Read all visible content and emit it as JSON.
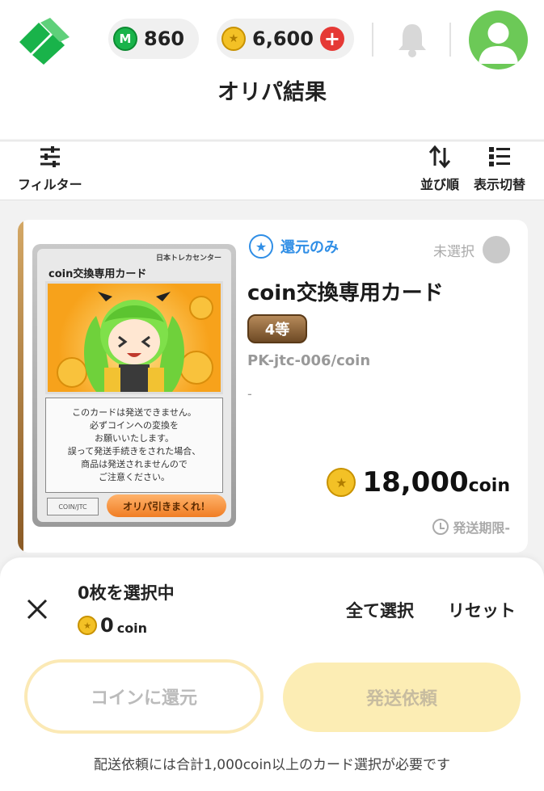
{
  "header": {
    "m_points": "860",
    "m_badge": "M",
    "coins": "6,600",
    "plus": "+"
  },
  "page": {
    "title": "オリパ結果"
  },
  "toolbar": {
    "filter_label": "フィルター",
    "sort_label": "並び順",
    "view_label": "表示切替"
  },
  "card": {
    "image": {
      "top_label": "日本トレカセンター",
      "name": "coin交換専用カード",
      "text_lines": [
        "このカードは発送できません。",
        "必ずコインへの変換を",
        "お願いいたします。",
        "誤って発送手続きをされた場合、",
        "商品は発送されませんので",
        "ご注意ください。"
      ],
      "code": "COIN/JTC",
      "button": "オリパ引きまくれ！"
    },
    "refund_tag": "還元のみ",
    "selection_status": "未選択",
    "name": "coin交換専用カード",
    "rank": "4等",
    "product_code": "PK-jtc-006/coin",
    "extra": "-",
    "price": "18,000",
    "price_unit": "coin",
    "deadline": "発送期限-"
  },
  "sheet": {
    "selected_count": "0枚を選択中",
    "selected_coin": "0",
    "selected_coin_unit": "coin",
    "select_all": "全て選択",
    "reset": "リセット",
    "refund_button": "コインに還元",
    "ship_button": "発送依頼",
    "note": "配送依頼には合計1,000coin以上のカード選択が必要です"
  },
  "colors": {
    "brand_green": "#19b34a",
    "accent_blue": "#2f8ee6",
    "coin_gold": "#f3c126",
    "alert_red": "#e53935"
  }
}
